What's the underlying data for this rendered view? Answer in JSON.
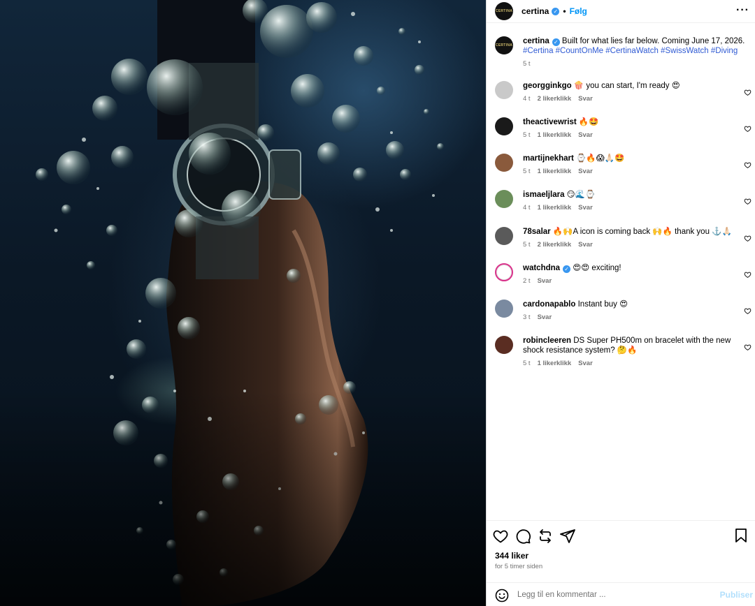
{
  "post": {
    "account": "certina",
    "follow_separator": "•",
    "follow_label": "Følg",
    "more_icon": "more-options-icon",
    "avatar_logo": "CERTINA"
  },
  "caption": {
    "username": "certina",
    "text": "Built for what lies far below. Coming June 17, 2026.",
    "hashtags": "#Certina #CountOnMe #CertinaWatch #SwissWatch #Diving",
    "time": "5 t"
  },
  "comments": [
    {
      "username": "georgginkgo",
      "text": "🍿 you can start, I'm ready 😍",
      "time": "4 t",
      "likes": "2 likerklikk",
      "reply": "Svar",
      "avatar_color": "#c9c9c9"
    },
    {
      "username": "theactivewrist",
      "text": "🔥🤩",
      "time": "5 t",
      "likes": "1 likerklikk",
      "reply": "Svar",
      "avatar_color": "#1a1a1a"
    },
    {
      "username": "martijnekhart",
      "text": "⌚️🔥😱🙏🏻🤩",
      "time": "5 t",
      "likes": "1 likerklikk",
      "reply": "Svar",
      "avatar_color": "#8a5a3c"
    },
    {
      "username": "ismaeljlara",
      "text": "😏🌊⌚️",
      "time": "4 t",
      "likes": "1 likerklikk",
      "reply": "Svar",
      "avatar_color": "#6b8e5a"
    },
    {
      "username": "78salar",
      "text": "🔥🙌A icon is coming back 🙌🔥 thank you ⚓️🙏🏻",
      "time": "5 t",
      "likes": "2 likerklikk",
      "reply": "Svar",
      "avatar_color": "#5a5a5a"
    },
    {
      "username": "watchdna",
      "text": "😍😍 exciting!",
      "time": "2 t",
      "likes": "",
      "reply": "Svar",
      "avatar_color": "#ffffff",
      "verified": true
    },
    {
      "username": "cardonapablo",
      "text": "Instant buy 😍",
      "time": "3 t",
      "likes": "",
      "reply": "Svar",
      "avatar_color": "#7a8aa0"
    },
    {
      "username": "robincleeren",
      "text": "DS Super PH500m on bracelet with the new shock resistance system? 🤔🔥",
      "time": "5 t",
      "likes": "1 likerklikk",
      "reply": "Svar",
      "avatar_color": "#5a2d22"
    }
  ],
  "actions": {
    "like_icon": "heart-icon",
    "comment_icon": "comment-icon",
    "repost_icon": "repost-icon",
    "share_icon": "share-icon",
    "save_icon": "bookmark-icon",
    "likes_count": "344 liker",
    "timestamp": "for 5 timer siden"
  },
  "composer": {
    "placeholder": "Legg til en kommentar ...",
    "publish_label": "Publiser",
    "emoji_icon": "emoji-icon"
  },
  "colors": {
    "link_blue": "#0095f6",
    "hashtag_blue": "#2f5ad3",
    "muted": "#737373",
    "verified": "#3897f0"
  }
}
